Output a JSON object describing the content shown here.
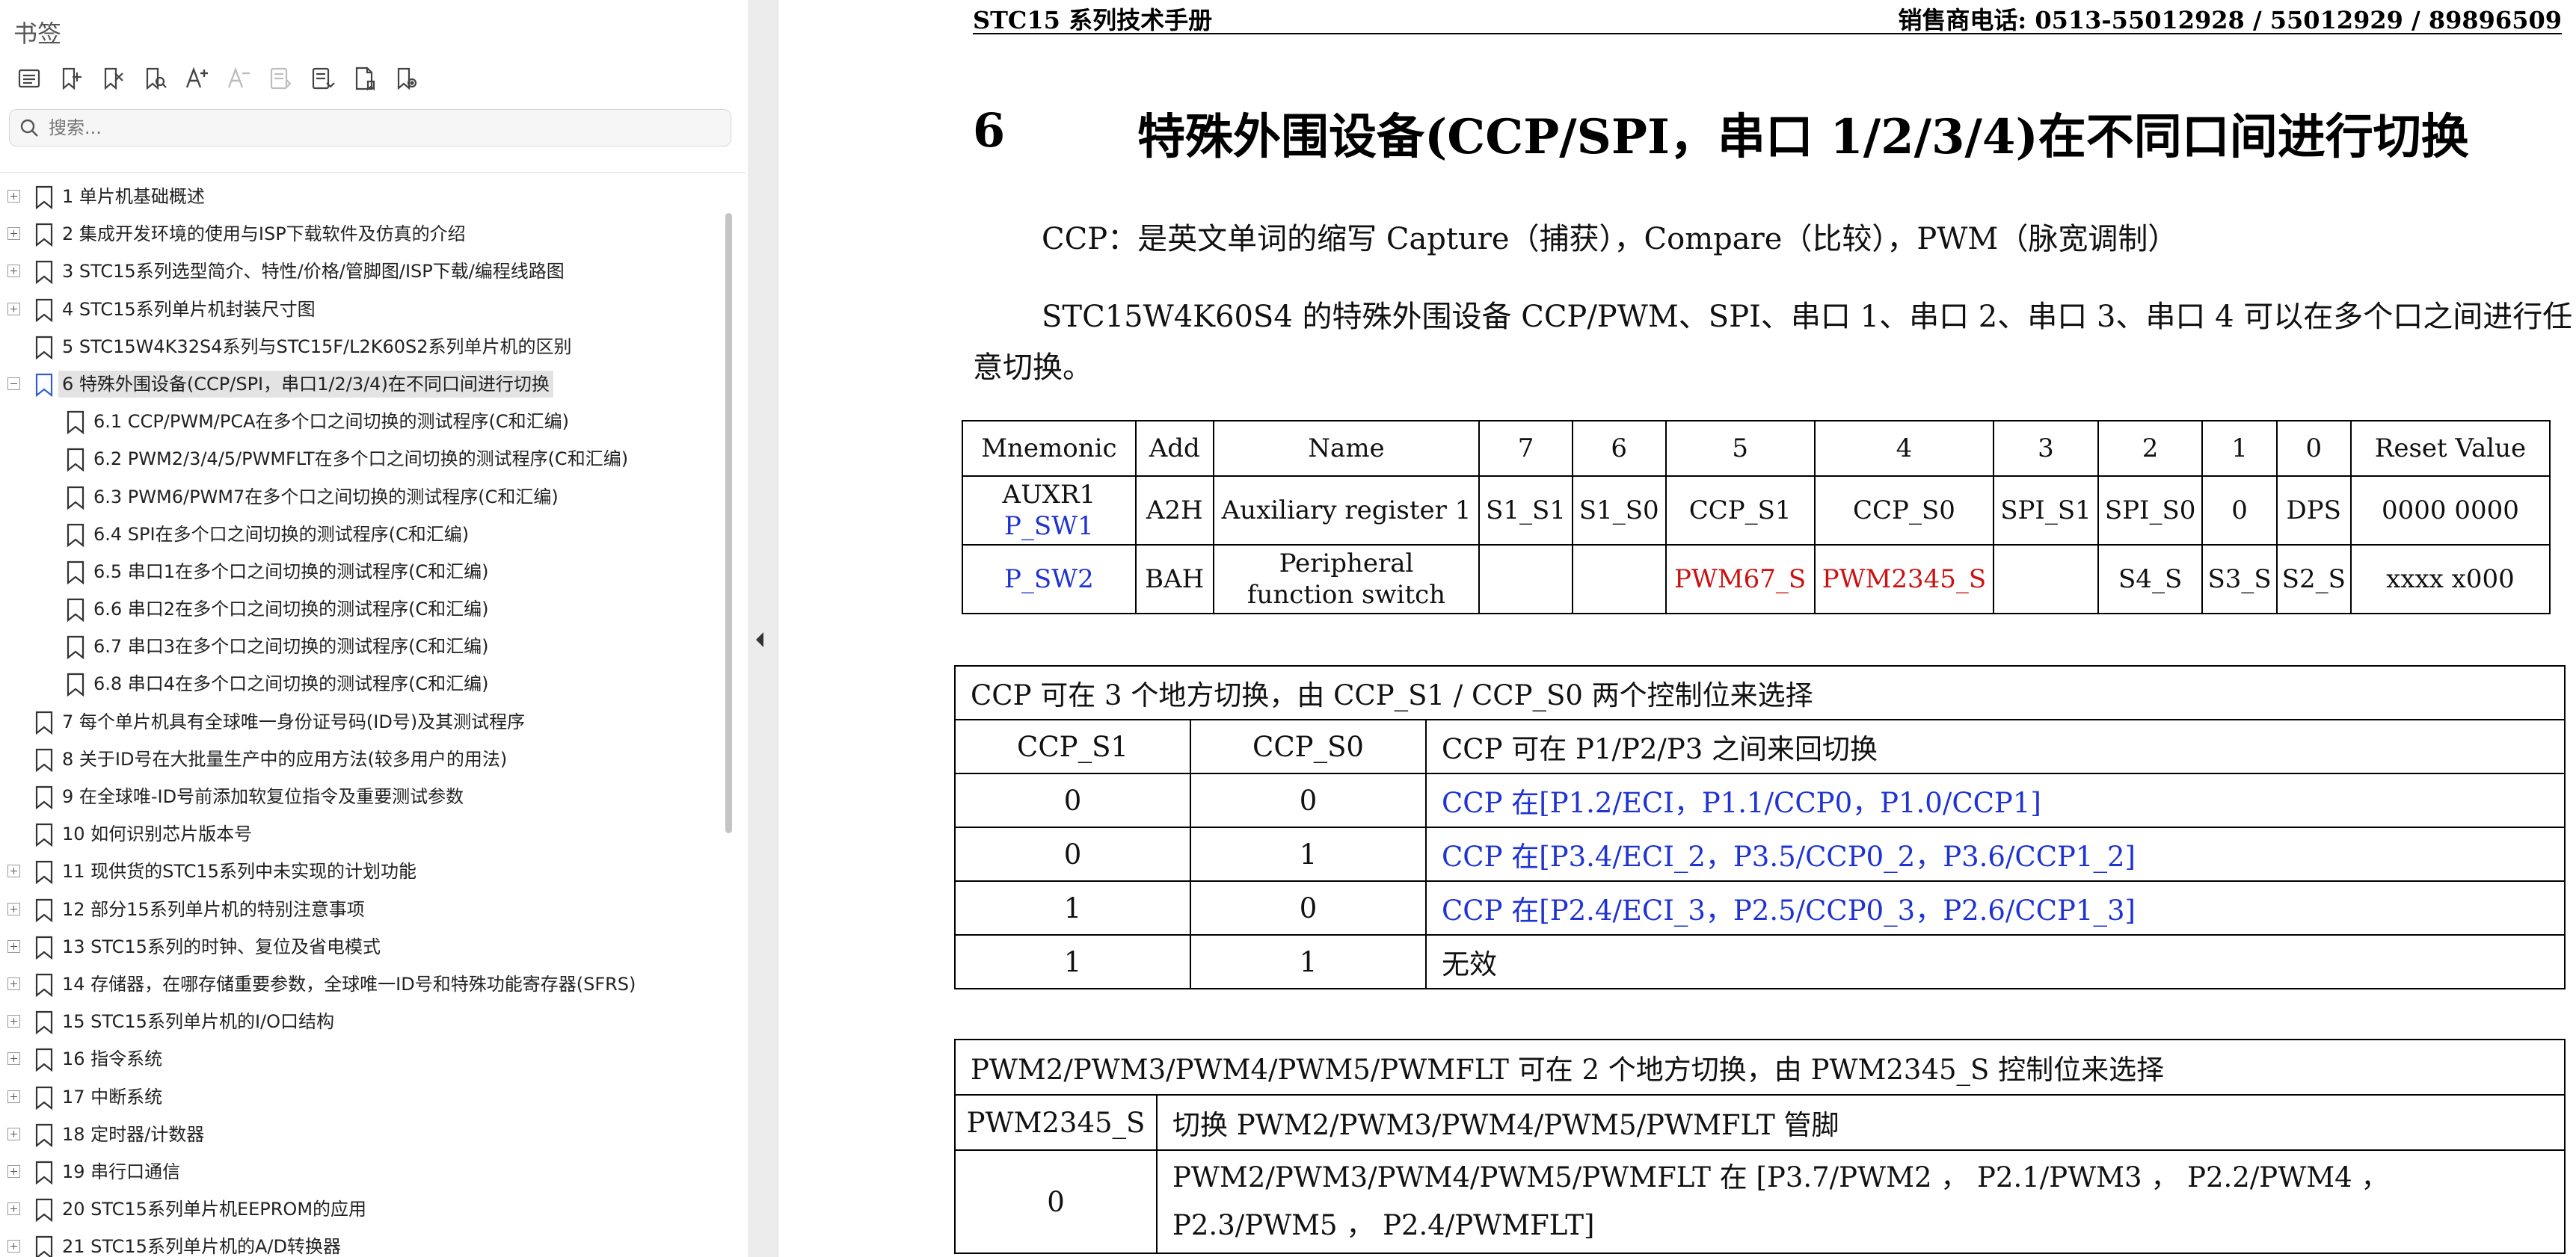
{
  "sidebar": {
    "title": "书签",
    "toolbar": [
      {
        "icon": "list-icon",
        "enabled": true
      },
      {
        "icon": "add-bookmark-icon",
        "enabled": true
      },
      {
        "icon": "delete-bookmark-icon",
        "enabled": true
      },
      {
        "icon": "find-bookmark-icon",
        "enabled": true
      },
      {
        "icon": "font-larger-icon",
        "enabled": true
      },
      {
        "icon": "font-smaller-icon",
        "enabled": false
      },
      {
        "icon": "expand-outline-icon",
        "enabled": false
      },
      {
        "icon": "collapse-outline-icon",
        "enabled": true
      },
      {
        "icon": "page-bookmark-icon",
        "enabled": true
      },
      {
        "icon": "locate-bookmark-icon",
        "enabled": true
      }
    ],
    "search_placeholder": "搜索...",
    "bookmarks": [
      {
        "label": "1 单片机基础概述",
        "level": 0,
        "expander": "plus"
      },
      {
        "label": "2  集成开发环境的使用与ISP下载软件及仿真的介绍",
        "level": 0,
        "expander": "plus"
      },
      {
        "label": "3  STC15系列选型简介、特性/价格/管脚图/ISP下载/编程线路图",
        "level": 0,
        "expander": "plus"
      },
      {
        "label": "4  STC15系列单片机封装尺寸图",
        "level": 0,
        "expander": "plus"
      },
      {
        "label": "5  STC15W4K32S4系列与STC15F/L2K60S2系列单片机的区别",
        "level": 0,
        "expander": "none"
      },
      {
        "label": "6  特殊外围设备(CCP/SPI，串口1/2/3/4)在不同口间进行切换",
        "level": 0,
        "expander": "minus",
        "selected": true
      },
      {
        "label": "6.1  CCP/PWM/PCA在多个口之间切换的测试程序(C和汇编)",
        "level": 1,
        "expander": "none"
      },
      {
        "label": "6.2 PWM2/3/4/5/PWMFLT在多个口之间切换的测试程序(C和汇编)",
        "level": 1,
        "expander": "none"
      },
      {
        "label": "6.3 PWM6/PWM7在多个口之间切换的测试程序(C和汇编)",
        "level": 1,
        "expander": "none"
      },
      {
        "label": "6.4 SPI在多个口之间切换的测试程序(C和汇编)",
        "level": 1,
        "expander": "none"
      },
      {
        "label": "6.5 串口1在多个口之间切换的测试程序(C和汇编)",
        "level": 1,
        "expander": "none"
      },
      {
        "label": "6.6 串口2在多个口之间切换的测试程序(C和汇编)",
        "level": 1,
        "expander": "none"
      },
      {
        "label": "6.7 串口3在多个口之间切换的测试程序(C和汇编)",
        "level": 1,
        "expander": "none"
      },
      {
        "label": "6.8 串口4在多个口之间切换的测试程序(C和汇编)",
        "level": 1,
        "expander": "none"
      },
      {
        "label": "7  每个单片机具有全球唯一身份证号码(ID号)及其测试程序",
        "level": 0,
        "expander": "none"
      },
      {
        "label": "8  关于ID号在大批量生产中的应用方法(较多用户的用法)",
        "level": 0,
        "expander": "none"
      },
      {
        "label": "9  在全球唯-ID号前添加软复位指令及重要测试参数",
        "level": 0,
        "expander": "none"
      },
      {
        "label": "10  如何识别芯片版本号",
        "level": 0,
        "expander": "none"
      },
      {
        "label": "11  现供货的STC15系列中未实现的计划功能",
        "level": 0,
        "expander": "plus"
      },
      {
        "label": "12  部分15系列单片机的特别注意事项",
        "level": 0,
        "expander": "plus"
      },
      {
        "label": "13  STC15系列的时钟、复位及省电模式",
        "level": 0,
        "expander": "plus"
      },
      {
        "label": "14  存储器，在哪存储重要参数，全球唯一ID号和特殊功能寄存器(SFRS)",
        "level": 0,
        "expander": "plus"
      },
      {
        "label": "15  STC15系列单片机的I/O口结构",
        "level": 0,
        "expander": "plus"
      },
      {
        "label": "16  指令系统",
        "level": 0,
        "expander": "plus"
      },
      {
        "label": "17  中断系统",
        "level": 0,
        "expander": "plus"
      },
      {
        "label": "18  定时器/计数器",
        "level": 0,
        "expander": "plus"
      },
      {
        "label": "19  串行口通信",
        "level": 0,
        "expander": "plus"
      },
      {
        "label": "20  STC15系列单片机EEPROM的应用",
        "level": 0,
        "expander": "plus"
      },
      {
        "label": "21  STC15系列单片机的A/D转换器",
        "level": 0,
        "expander": "plus"
      }
    ]
  },
  "page": {
    "header_left": "STC15 系列技术手册",
    "header_right": "销售商电话: 0513-55012928 / 55012929 / 89896509",
    "section_number": "6",
    "section_title": "特殊外围设备(CCP/SPI，串口 1/2/3/4)在不同口间进行切换",
    "para1": "CCP：是英文单词的缩写 Capture（捕获），Compare（比较），PWM（脉宽调制）",
    "para2": "STC15W4K60S4 的特殊外围设备 CCP/PWM、SPI、串口 1、串口 2、串口 3、串口 4 可以在多个口之间进行任意切换。",
    "reg_table": {
      "headers": [
        "Mnemonic",
        "Add",
        "Name",
        "7",
        "6",
        "5",
        "4",
        "3",
        "2",
        "1",
        "0",
        "Reset Value"
      ],
      "row1": {
        "mnemonic_1": "AUXR1",
        "mnemonic_2": "P_SW1",
        "add": "A2H",
        "name": "Auxiliary register 1",
        "bits": [
          "S1_S1",
          "S1_S0",
          "CCP_S1",
          "CCP_S0",
          "SPI_S1",
          "SPI_S0",
          "0",
          "DPS"
        ],
        "reset": "0000 0000"
      },
      "row2": {
        "mnemonic": "P_SW2",
        "add": "BAH",
        "name_1": "Peripheral",
        "name_2": "function switch",
        "bits": [
          "",
          "",
          "PWM67_S",
          "PWM2345_S",
          "",
          "S4_S",
          "S3_S",
          "S2_S"
        ],
        "reset": "xxxx x000"
      }
    },
    "ccp_table": {
      "title": "CCP 可在 3 个地方切换，由  CCP_S1 / CCP_S0  两个控制位来选择",
      "headers": [
        "CCP_S1",
        "CCP_S0",
        "CCP 可在 P1/P2/P3 之间来回切换"
      ],
      "rows": [
        [
          "0",
          "0",
          "CCP 在[P1.2/ECI，P1.1/CCP0，P1.0/CCP1]"
        ],
        [
          "0",
          "1",
          "CCP 在[P3.4/ECI_2，P3.5/CCP0_2，P3.6/CCP1_2]"
        ],
        [
          "1",
          "0",
          "CCP 在[P2.4/ECI_3，P2.5/CCP0_3，P2.6/CCP1_3]"
        ],
        [
          "1",
          "1",
          "无效"
        ]
      ]
    },
    "pwm_table": {
      "title": "PWM2/PWM3/PWM4/PWM5/PWMFLT 可在 2 个地方切换，由  PWM2345_S  控制位来选择",
      "headers": [
        "PWM2345_S",
        "切换 PWM2/PWM3/PWM4/PWM5/PWMFLT 管脚"
      ],
      "rows": [
        [
          "0",
          "PWM2/PWM3/PWM4/PWM5/PWMFLT   在 [P3.7/PWM2 ，  P2.1/PWM3 ，  P2.2/PWM4 ，  P2.3/PWM5 ，  P2.4/PWMFLT]"
        ]
      ]
    }
  }
}
